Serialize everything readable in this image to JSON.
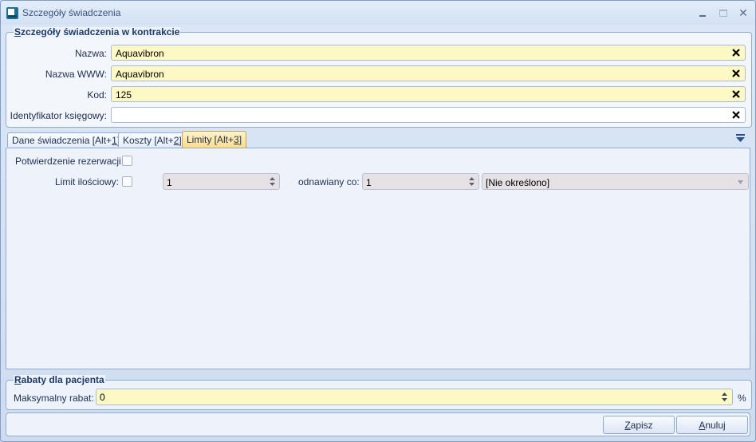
{
  "window": {
    "title": "Szczegóły świadczenia",
    "controls": {
      "minimize": "_",
      "maximize": "□",
      "close": "✕"
    }
  },
  "contract_group": {
    "title_first": "S",
    "title_rest": "zczegóły świadczenia w kontrakcie",
    "fields": [
      {
        "label": "Nazwa:",
        "value": "Aquavibron",
        "highlight": true
      },
      {
        "label": "Nazwa WWW:",
        "value": "Aquavibron",
        "highlight": true
      },
      {
        "label": "Kod:",
        "value": "125",
        "highlight": true
      },
      {
        "label": "Identyfikator księgowy:",
        "value": "",
        "highlight": false
      }
    ]
  },
  "tabs": [
    {
      "prefix": "Dane świadczenia [Alt+",
      "key": "1",
      "suffix": "]",
      "active": false
    },
    {
      "prefix": "Koszty [Alt+",
      "key": "2",
      "suffix": "]",
      "active": false
    },
    {
      "prefix": "Limity [Alt+",
      "key": "3",
      "suffix": "]",
      "active": true
    }
  ],
  "limits": {
    "reservation_label": "Potwierdzenie rezerwacji:",
    "quantity_label": "Limit ilościowy:",
    "quantity_value": "1",
    "renewed_label": "odnawiany co:",
    "renewed_value": "1",
    "period_value": "[Nie określono]"
  },
  "discount_group": {
    "title_first": "R",
    "title_rest": "abaty dla pacjenta",
    "max_label": "Maksymalny rabat:",
    "max_value": "0",
    "unit": "%"
  },
  "buttons": {
    "save_first": "Z",
    "save_rest": "apisz",
    "cancel_first": "A",
    "cancel_rest": "nuluj"
  },
  "colors": {
    "highlight_field": "#fdf9c4",
    "active_tab": "#fddd8a",
    "frame_border": "#8fadd4"
  }
}
